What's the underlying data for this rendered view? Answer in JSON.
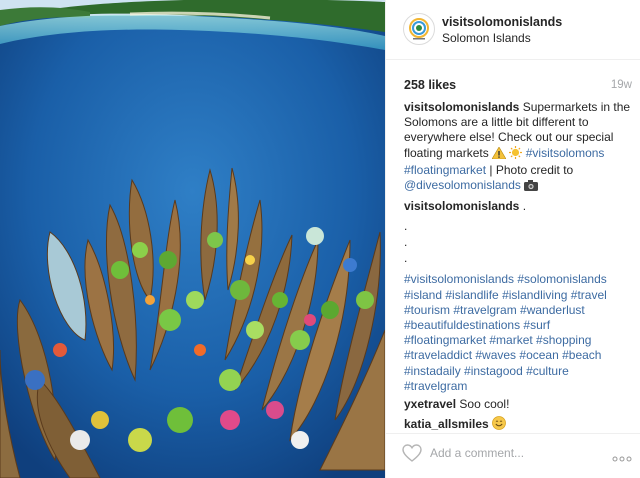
{
  "post": {
    "username": "visitsolomonislands",
    "location": "Solomon Islands",
    "likes": "258 likes",
    "time_ago": "19w",
    "caption": {
      "user": "visitsolomonislands",
      "text_1": "Supermarkets in the Solomons are a little bit different to everywhere else! Check out our special floating markets",
      "tag_1": "#visitsolomons",
      "tag_2": "#floatingmarket",
      "text_2": "| Photo credit to",
      "mention": "@divesolomonislands"
    },
    "follow_up": {
      "user": "visitsolomonislands",
      "text": ".",
      "dots": [
        ".",
        ".",
        "."
      ],
      "hashtags": "#visitsolomonislands #solomonislands #island #islandlife #islandliving #travel #tourism #travelgram #wanderlust #beautifuldestinations #surf #floatingmarket #market #shopping #traveladdict #waves #ocean #beach #instadaily #instagood #culture #travelgram"
    },
    "comments": [
      {
        "user": "yxetravel",
        "text": "Soo cool!"
      },
      {
        "user": "katia_allsmiles",
        "text": ""
      }
    ],
    "add_comment_placeholder": "Add a comment...",
    "icons": {
      "like": "heart-outline-icon",
      "more": "more-options-icon",
      "warning_emoji": "warning-emoji-icon",
      "sun_emoji": "sun-emoji-icon",
      "camera_emoji": "camera-emoji-icon",
      "smile_emoji": "smile-emoji-icon"
    },
    "colors": {
      "link": "#3d6ba2",
      "text": "#262626",
      "muted": "#a5a7aa",
      "ocean": "#1b5fa6"
    }
  }
}
